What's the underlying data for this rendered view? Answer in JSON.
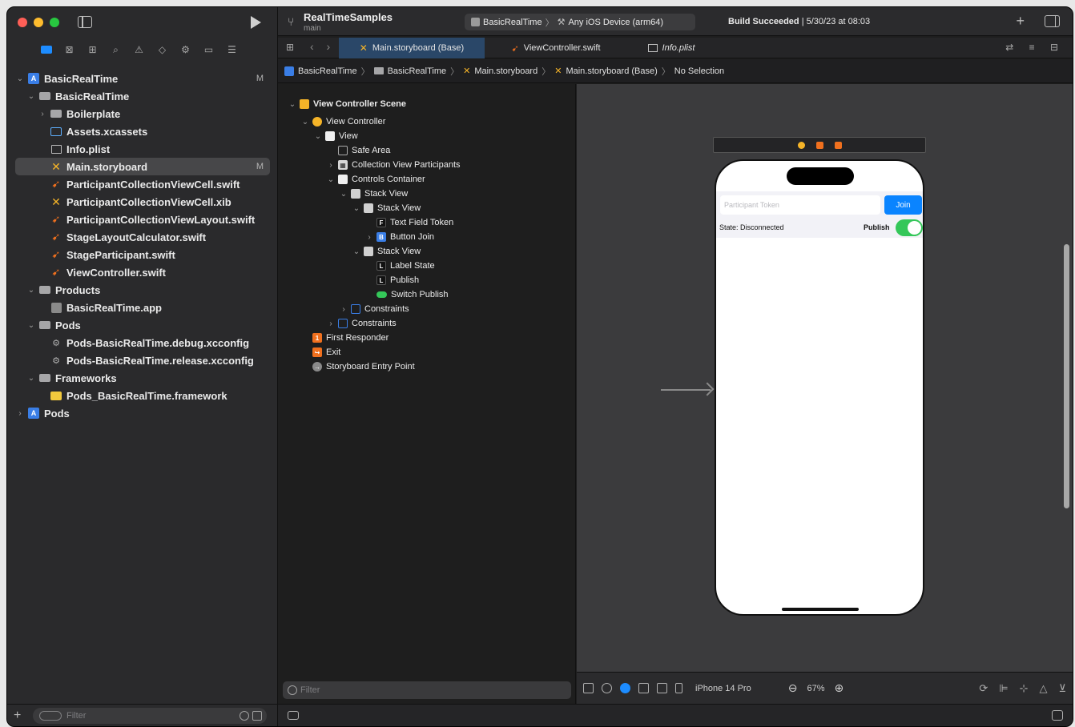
{
  "toolbar": {
    "project_title": "RealTimeSamples",
    "branch": "main",
    "scheme_target": "BasicRealTime",
    "scheme_device": "Any iOS Device (arm64)",
    "status_bold": "Build Succeeded",
    "status_rest": " | 5/30/23 at 08:03"
  },
  "navigator": {
    "items": [
      {
        "label": "BasicRealTime",
        "badge": "M"
      },
      {
        "label": "BasicRealTime"
      },
      {
        "label": "Boilerplate"
      },
      {
        "label": "Assets.xcassets"
      },
      {
        "label": "Info.plist"
      },
      {
        "label": "Main.storyboard",
        "badge": "M"
      },
      {
        "label": "ParticipantCollectionViewCell.swift"
      },
      {
        "label": "ParticipantCollectionViewCell.xib"
      },
      {
        "label": "ParticipantCollectionViewLayout.swift"
      },
      {
        "label": "StageLayoutCalculator.swift"
      },
      {
        "label": "StageParticipant.swift"
      },
      {
        "label": "ViewController.swift"
      },
      {
        "label": "Products"
      },
      {
        "label": "BasicRealTime.app"
      },
      {
        "label": "Pods"
      },
      {
        "label": "Pods-BasicRealTime.debug.xcconfig"
      },
      {
        "label": "Pods-BasicRealTime.release.xcconfig"
      },
      {
        "label": "Frameworks"
      },
      {
        "label": "Pods_BasicRealTime.framework"
      },
      {
        "label": "Pods"
      }
    ],
    "filter_placeholder": "Filter"
  },
  "tabs": [
    {
      "label": "Main.storyboard (Base)"
    },
    {
      "label": "ViewController.swift"
    },
    {
      "label": "Info.plist"
    }
  ],
  "breadcrumb": [
    "BasicRealTime",
    "BasicRealTime",
    "Main.storyboard",
    "Main.storyboard (Base)",
    "No Selection"
  ],
  "outline": {
    "items": [
      {
        "label": "View Controller Scene"
      },
      {
        "label": "View Controller"
      },
      {
        "label": "View"
      },
      {
        "label": "Safe Area"
      },
      {
        "label": "Collection View Participants"
      },
      {
        "label": "Controls Container"
      },
      {
        "label": "Stack View"
      },
      {
        "label": "Stack View"
      },
      {
        "label": "Text Field Token"
      },
      {
        "label": "Button Join"
      },
      {
        "label": "Stack View"
      },
      {
        "label": "Label State"
      },
      {
        "label": "Publish"
      },
      {
        "label": "Switch Publish"
      },
      {
        "label": "Constraints"
      },
      {
        "label": "Constraints"
      },
      {
        "label": "First Responder"
      },
      {
        "label": "Exit"
      },
      {
        "label": "Storyboard Entry Point"
      }
    ],
    "filter_placeholder": "Filter"
  },
  "phone": {
    "token_placeholder": "Participant Token",
    "join_label": "Join",
    "state_label": "State: Disconnected",
    "publish_label": "Publish",
    "publish_on": true
  },
  "canvas_bar": {
    "device": "iPhone 14 Pro",
    "zoom": "67%"
  },
  "colors": {
    "accent": "#1d8cff",
    "swift": "#f0701e",
    "storyboard": "#f5b428",
    "switch_on": "#34c759",
    "selected_tab": "#2a4768"
  }
}
